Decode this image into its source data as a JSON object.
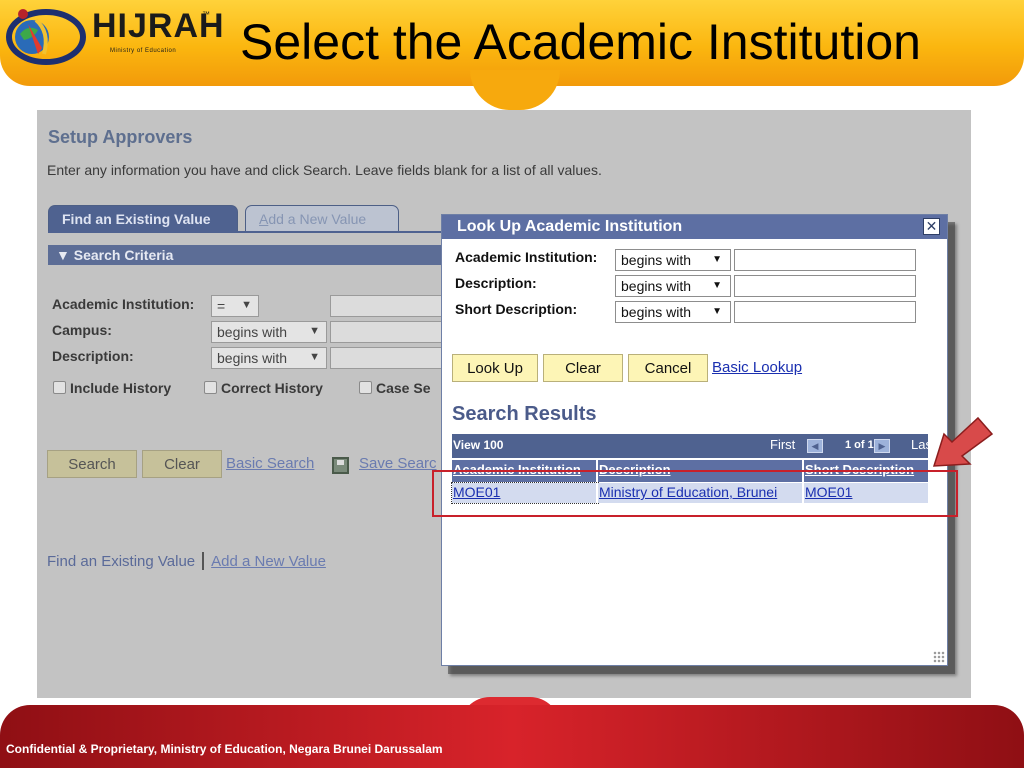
{
  "slide": {
    "title": "Select the Academic Institution",
    "logo_text": "HIJRAH",
    "logo_tm": "™",
    "logo_subtitle": "Ministry of Education",
    "footer": "Confidential & Proprietary, Ministry of Education, Negara Brunei Darussalam"
  },
  "page": {
    "title": "Setup Approvers",
    "instructions": "Enter any information you have and click Search. Leave fields blank for a list of all values.",
    "tabs": {
      "find": "Find an Existing Value",
      "add_prefix": "A",
      "add_rest": "dd a New Value"
    },
    "criteria_header": "▼ Search Criteria",
    "fields": [
      {
        "label": "Academic Institution:",
        "operator": "="
      },
      {
        "label": "Campus:",
        "operator": "begins with"
      },
      {
        "label": "Description:",
        "operator": "begins with"
      }
    ],
    "checkboxes": [
      "Include History",
      "Correct History",
      "Case Se"
    ],
    "buttons": {
      "search": "Search",
      "clear": "Clear"
    },
    "links": {
      "basic_search": "Basic Search",
      "save_search": "Save Searc"
    },
    "bottom_links": {
      "find": "Find an Existing Value",
      "add": "Add a New Value"
    }
  },
  "dialog": {
    "title": "Look Up Academic Institution",
    "close": "✕",
    "fields": [
      {
        "label": "Academic Institution:",
        "operator": "begins with",
        "value": ""
      },
      {
        "label": "Description:",
        "operator": "begins with",
        "value": ""
      },
      {
        "label": "Short Description:",
        "operator": "begins with",
        "value": ""
      }
    ],
    "buttons": {
      "lookup": "Look Up",
      "clear": "Clear",
      "cancel": "Cancel"
    },
    "basic_lookup": "Basic Lookup",
    "results_title": "Search Results",
    "nav": {
      "view": "View 100",
      "first": "First",
      "count": "1 of 1",
      "last": "Last",
      "prev": "◀",
      "next": "▶"
    },
    "columns": [
      "Academic Institution",
      "Description",
      "Short Description"
    ],
    "rows": [
      [
        "MOE01",
        "Ministry of Education, Brunei",
        "MOE01"
      ]
    ]
  },
  "colors": {
    "header_orange": "#fbb60f",
    "footer_red": "#d8232a",
    "dialog_title_bar": "#5d6fa3",
    "highlight_red": "#c8202a"
  }
}
